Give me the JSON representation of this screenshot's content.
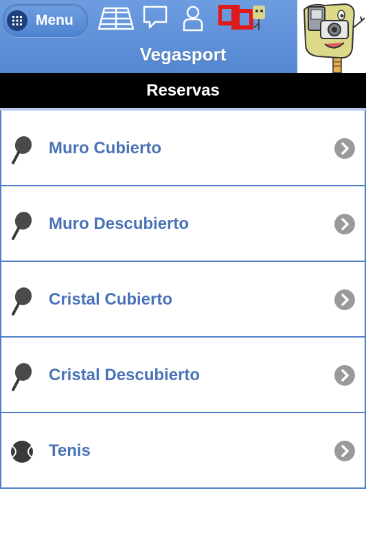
{
  "header": {
    "menu_label": "Menu",
    "title": "Vegasport",
    "icons": [
      "court-icon",
      "chat-icon",
      "user-icon",
      "brand-logo-icon"
    ]
  },
  "section": {
    "title": "Reservas"
  },
  "items": [
    {
      "label": "Muro Cubierto",
      "icon": "padel-racket-icon"
    },
    {
      "label": "Muro Descubierto",
      "icon": "padel-racket-icon"
    },
    {
      "label": "Cristal Cubierto",
      "icon": "padel-racket-icon"
    },
    {
      "label": "Cristal Descubierto",
      "icon": "padel-racket-icon"
    },
    {
      "label": "Tenis",
      "icon": "tennis-ball-icon"
    }
  ],
  "colors": {
    "header": "#5c8fd8",
    "section_bar": "#000000",
    "item_text": "#4a73b6",
    "item_border": "#4f7fc8",
    "chevron": "#9a9a9a"
  }
}
